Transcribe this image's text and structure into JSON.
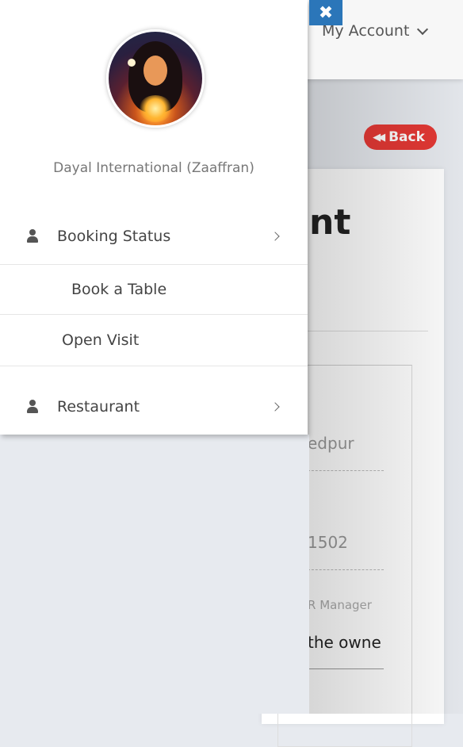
{
  "header": {
    "account_label": "My Account"
  },
  "back_button": {
    "label": "Back"
  },
  "background_card": {
    "title_fragment": "nt",
    "field1_value": "edpur",
    "field2_value": "1502",
    "manager_label": "R Manager",
    "select_value": "the owne"
  },
  "drawer": {
    "profile_name": "Dayal International (Zaaffran)",
    "menu": [
      {
        "label": "Booking Status"
      },
      {
        "label": "Book a Table"
      },
      {
        "label": "Open Visit"
      },
      {
        "label": "Restaurant"
      }
    ]
  },
  "icons": {
    "close": "close-icon",
    "user": "user-icon",
    "chevron": "chevron-right-icon"
  }
}
